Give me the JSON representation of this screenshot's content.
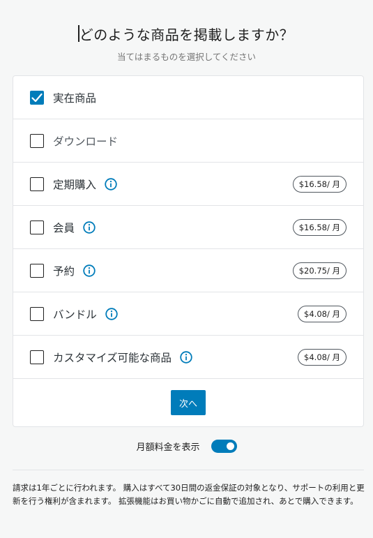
{
  "header": {
    "title": "どのような商品を掲載しますか？",
    "subtitle": "当てはまるものを選択してください"
  },
  "options": [
    {
      "label": "実在商品",
      "checked": true,
      "info": false,
      "price": ""
    },
    {
      "label": "ダウンロード",
      "checked": false,
      "info": false,
      "price": ""
    },
    {
      "label": "定期購入",
      "checked": false,
      "info": true,
      "price": "$16.58/ 月"
    },
    {
      "label": "会員",
      "checked": false,
      "info": true,
      "price": "$16.58/ 月"
    },
    {
      "label": "予約",
      "checked": false,
      "info": true,
      "price": "$20.75/ 月"
    },
    {
      "label": "バンドル",
      "checked": false,
      "info": true,
      "price": "$4.08/ 月"
    },
    {
      "label": "カスタマイズ可能な商品",
      "checked": false,
      "info": true,
      "price": "$4.08/ 月"
    }
  ],
  "next_button": "次へ",
  "monthly_toggle": {
    "label": "月額料金を表示",
    "on": true
  },
  "footer_text": "請求は1年ごとに行われます。 購入はすべて30日間の返金保証の対象となり、サポートの利用と更新を行う権利が含まれます。 拡張機能はお買い物かごに自動で追加され、あとで購入できます。",
  "colors": {
    "accent": "#007cba",
    "border": "#e2e4e7",
    "background": "#f6f7f7"
  },
  "icons": {
    "check": "checkmark-icon",
    "info": "info-icon"
  }
}
